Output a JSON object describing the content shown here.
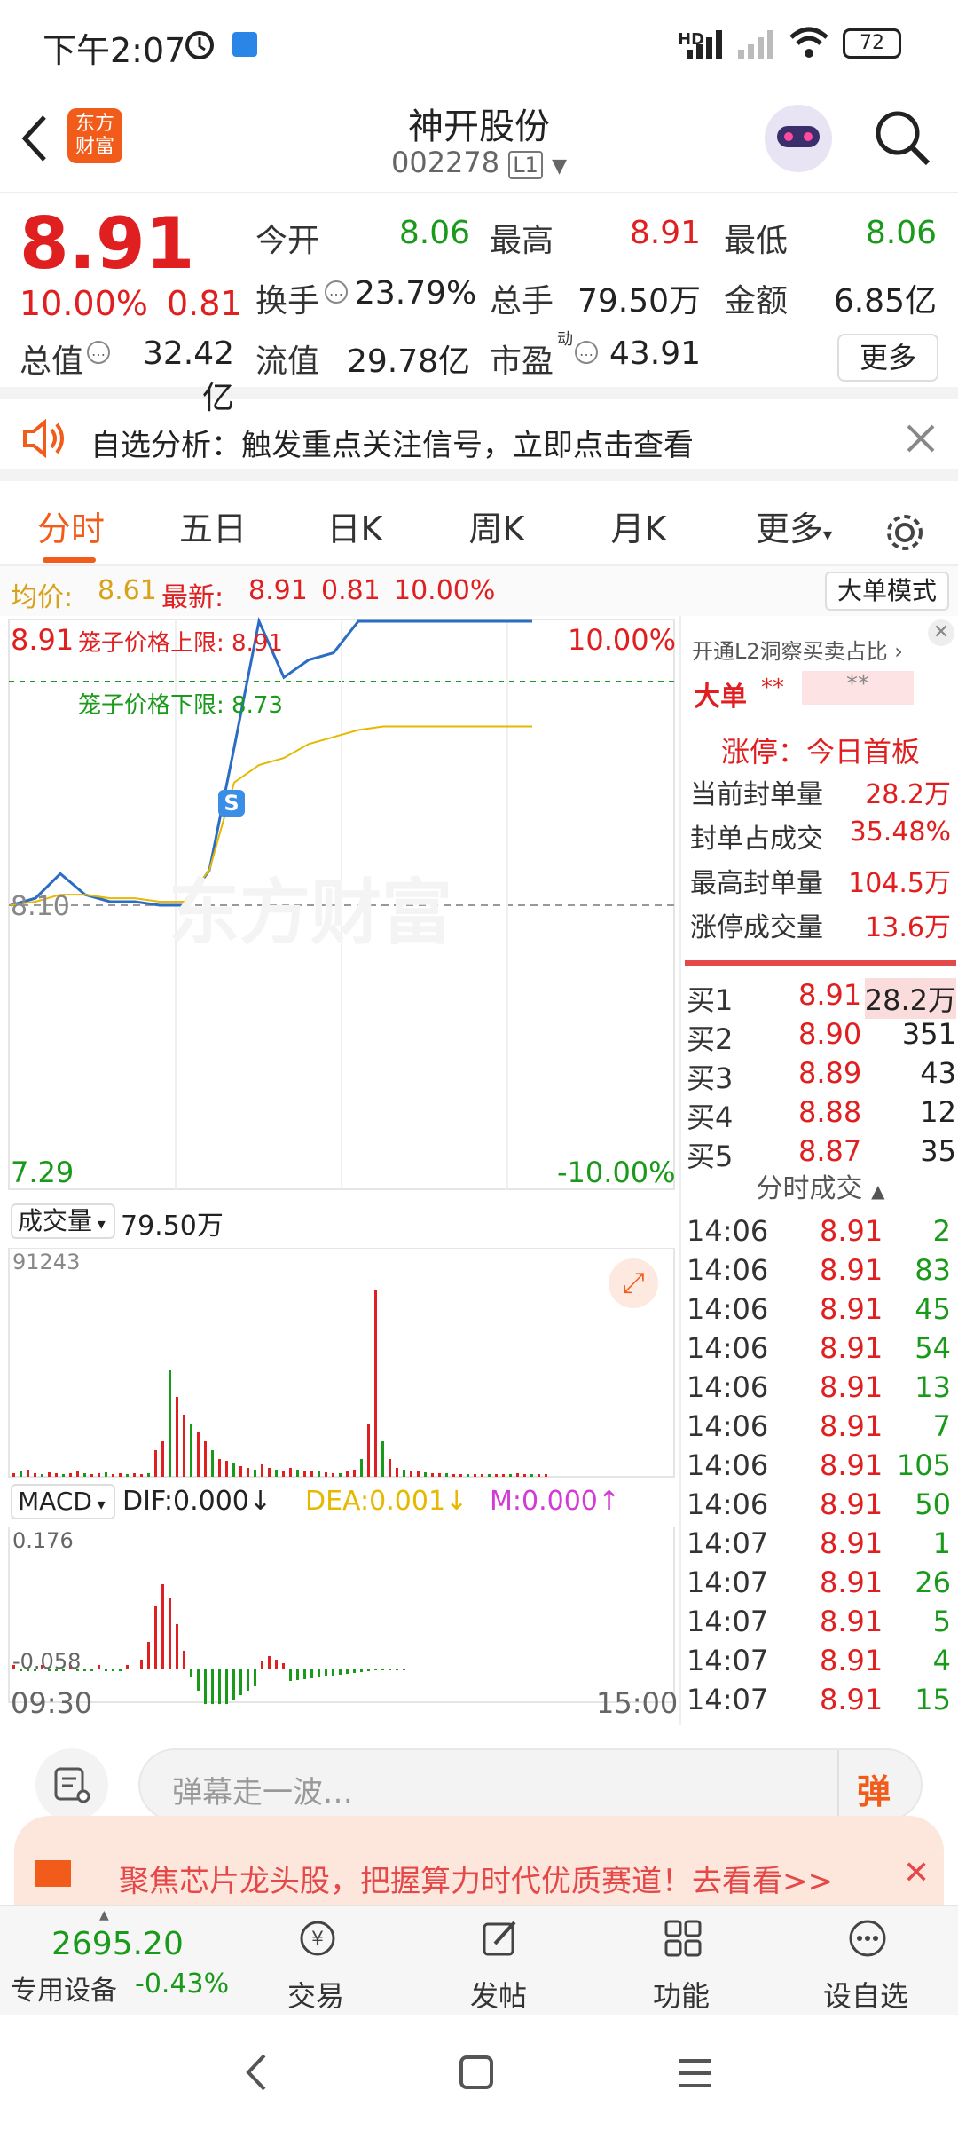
{
  "status": {
    "time": "下午2:07",
    "battery": "72",
    "net": "HD"
  },
  "header": {
    "title": "神开股份",
    "code": "002278",
    "level": "L1",
    "logo_line1": "东方",
    "logo_line2": "财富"
  },
  "quote": {
    "price": "8.91",
    "pct": "10.00%",
    "chg": "0.81",
    "open_label": "今开",
    "open": "8.06",
    "high_label": "最高",
    "high": "8.91",
    "low_label": "最低",
    "low": "8.06",
    "turnover_label": "换手",
    "turnover": "23.79%",
    "vol_label": "总手",
    "vol": "79.50万",
    "amount_label": "金额",
    "amount": "6.85亿",
    "mcap_label": "总值",
    "mcap": "32.42亿",
    "float_label": "流值",
    "float": "29.78亿",
    "pe_label": "市盈",
    "pe_sup": "动",
    "pe": "43.91",
    "more": "更多"
  },
  "banner": {
    "text": "自选分析：触发重点关注信号，立即点击查看"
  },
  "tabs": [
    "分时",
    "五日",
    "日K",
    "周K",
    "月K",
    "更多"
  ],
  "infoline": {
    "avg_label": "均价:",
    "avg": "8.61",
    "last_label": "最新:",
    "last": "8.91",
    "chg": "0.81",
    "pct": "10.00%",
    "mode": "大单模式"
  },
  "chart": {
    "top_price": "8.91",
    "top_pct": "10.00%",
    "upper_limit": "笼子价格上限: 8.91",
    "lower_limit": "笼子价格下限: 8.73",
    "base_price": "8.10",
    "bottom_price": "7.29",
    "bottom_pct": "-10.00%",
    "watermark": "东方财富",
    "s_marker": "S",
    "vol_label": "成交量",
    "vol_value": "79.50万",
    "vol_max": "91243",
    "macd_label": "MACD",
    "dif": "DIF:0.000↓",
    "dea": "DEA:0.001↓",
    "m": "M:0.000↑",
    "macd_top": "0.176",
    "macd_bottom": "-0.058",
    "time_start": "09:30",
    "time_end": "15:00"
  },
  "chart_data": {
    "type": "line",
    "ylim": [
      7.29,
      8.91
    ],
    "base": 8.1,
    "series": [
      {
        "values": [
          8.1,
          8.12,
          8.19,
          8.13,
          8.11,
          8.11,
          8.1,
          8.1,
          8.2,
          8.55,
          8.91,
          8.75,
          8.8,
          8.82,
          8.91,
          8.91,
          8.91,
          8.91,
          8.91,
          8.91,
          8.91,
          8.91
        ]
      },
      {
        "values": [
          8.1,
          8.11,
          8.13,
          8.13,
          8.12,
          8.12,
          8.11,
          8.11,
          8.2,
          8.45,
          8.5,
          8.52,
          8.56,
          8.58,
          8.6,
          8.61,
          8.61,
          8.61,
          8.61,
          8.61,
          8.61,
          8.61
        ]
      }
    ]
  },
  "rightpanel": {
    "l2": "开通L2洞察买卖占比",
    "bigorder": "大单",
    "stars1": "**",
    "stars2": "**",
    "limit_title": "涨停：今日首板",
    "rows": [
      {
        "label": "当前封单量",
        "value": "28.2万"
      },
      {
        "label": "封单占成交",
        "value": "35.48%"
      },
      {
        "label": "最高封单量",
        "value": "104.5万"
      },
      {
        "label": "涨停成交量",
        "value": "13.6万"
      }
    ],
    "bids": [
      {
        "label": "买1",
        "price": "8.91",
        "vol": "28.2万"
      },
      {
        "label": "买2",
        "price": "8.90",
        "vol": "351"
      },
      {
        "label": "买3",
        "price": "8.89",
        "vol": "43"
      },
      {
        "label": "买4",
        "price": "8.88",
        "vol": "12"
      },
      {
        "label": "买5",
        "price": "8.87",
        "vol": "35"
      }
    ],
    "trades_title": "分时成交",
    "trades": [
      {
        "t": "14:06",
        "p": "8.91",
        "v": "2"
      },
      {
        "t": "14:06",
        "p": "8.91",
        "v": "83"
      },
      {
        "t": "14:06",
        "p": "8.91",
        "v": "45"
      },
      {
        "t": "14:06",
        "p": "8.91",
        "v": "54"
      },
      {
        "t": "14:06",
        "p": "8.91",
        "v": "13"
      },
      {
        "t": "14:06",
        "p": "8.91",
        "v": "7"
      },
      {
        "t": "14:06",
        "p": "8.91",
        "v": "105"
      },
      {
        "t": "14:06",
        "p": "8.91",
        "v": "50"
      },
      {
        "t": "14:07",
        "p": "8.91",
        "v": "1"
      },
      {
        "t": "14:07",
        "p": "8.91",
        "v": "26"
      },
      {
        "t": "14:07",
        "p": "8.91",
        "v": "5"
      },
      {
        "t": "14:07",
        "p": "8.91",
        "v": "4"
      },
      {
        "t": "14:07",
        "p": "8.91",
        "v": "15"
      }
    ]
  },
  "comment": {
    "placeholder": "弹幕走一波…",
    "btn": "弹"
  },
  "ad": {
    "text": "聚焦芯片龙头股，把握算力时代优质赛道！去看看>>"
  },
  "bottomnav": {
    "index_value": "2695.20",
    "index_label": "专用设备",
    "index_pct": "-0.43%",
    "items": [
      "交易",
      "发帖",
      "功能",
      "设自选"
    ]
  }
}
